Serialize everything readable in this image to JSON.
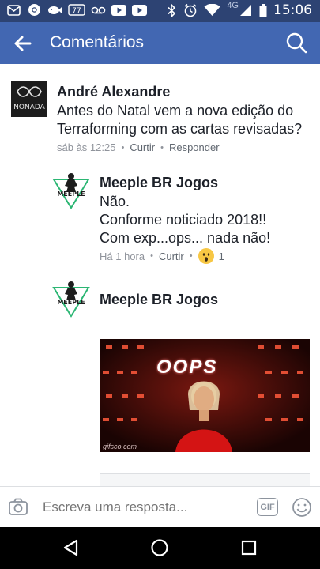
{
  "status_bar": {
    "network": "4G",
    "time": "15:06",
    "left_icons": [
      "mail-icon",
      "chrome-icon",
      "fish-icon",
      "phone-77-icon",
      "voicemail-icon",
      "youtube-icon",
      "youtube-icon"
    ],
    "right_icons": [
      "bluetooth-icon",
      "alarm-icon",
      "wifi-icon",
      "signal-icon",
      "battery-icon"
    ],
    "phone_badge": "77"
  },
  "app_bar": {
    "title": "Comentários",
    "back_icon": "arrow-left-icon",
    "search_icon": "search-icon"
  },
  "comments": [
    {
      "author": "André Alexandre",
      "avatar_text": "NONADA",
      "text": "Antes do Natal vem a nova edição do\nTerraforming com as cartas revisadas?",
      "time": "sáb às 12:25",
      "like": "Curtir",
      "reply": "Responder"
    }
  ],
  "replies": [
    {
      "author": "Meeple BR Jogos",
      "avatar_text": "MEEPLE",
      "text": "Não.\nConforme noticiado 2018!!\nCom exp...ops... nada não!",
      "time": "Há 1 hora",
      "like": "Curtir",
      "reaction_count": "1",
      "reaction_icon": "wow-emoji-icon"
    },
    {
      "author": "Meeple BR Jogos",
      "avatar_text": "MEEPLE",
      "gif_text": "OOPS",
      "gif_source": "gifsco.com"
    }
  ],
  "composer": {
    "placeholder": "Escreva uma resposta...",
    "gif_label": "GIF",
    "camera_icon": "camera-icon",
    "emoji_icon": "smiley-icon"
  },
  "colors": {
    "status_bar": "#2d4373",
    "app_bar": "#4267b2",
    "text": "#1d2129",
    "meta": "#90949c"
  }
}
